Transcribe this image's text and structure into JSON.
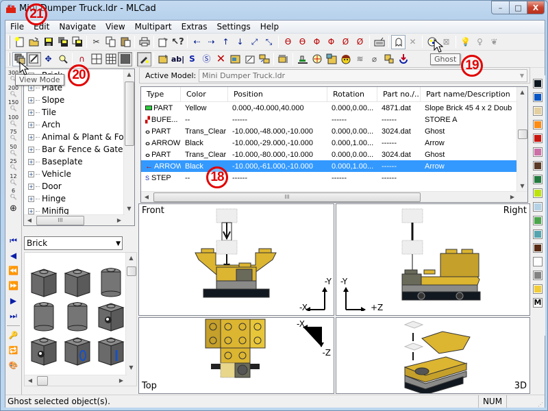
{
  "window": {
    "title": "Mini Dumper Truck.ldr - MLCad",
    "min_label": "–",
    "max_label": "□",
    "close_label": "X"
  },
  "menu": [
    "File",
    "Edit",
    "Navigate",
    "View",
    "Multipart",
    "Extras",
    "Settings",
    "Help"
  ],
  "toolbar1": {
    "groups": [
      [
        "new-icon",
        "open-icon",
        "save-icon",
        "save-as-icon",
        "save-all-icon"
      ],
      [
        "cut-icon",
        "copy-icon",
        "paste-icon"
      ],
      [
        "print-icon"
      ],
      [
        "properties-icon",
        "context-help-icon"
      ],
      [
        "move-neg-x-icon",
        "move-pos-x-icon",
        "move-neg-y-icon",
        "move-pos-y-icon",
        "move-pos-z-icon",
        "move-neg-z-icon"
      ],
      [
        "rotate-x-neg-icon",
        "rotate-x-pos-icon",
        "rotate-y-neg-icon",
        "rotate-y-pos-icon",
        "rotate-z-neg-icon",
        "rotate-z-pos-icon"
      ],
      [
        "keyboard-icon"
      ],
      [
        "ghost-icon",
        "unghost-icon"
      ],
      [
        "color-icon",
        "hide-icon"
      ],
      [
        "light-on-icon",
        "light-off-icon",
        "light-all-icon"
      ]
    ]
  },
  "toolbar2": {
    "groups": [
      [
        "view-mode-icon",
        "edit-mode-icon",
        "move-mode-icon",
        "zoom-mode-icon"
      ],
      [
        "magnet-icon",
        "grid-coarse-icon",
        "grid-medium-icon",
        "grid-fine-icon"
      ],
      [
        "draw-mode-icon"
      ],
      [
        "add-part-icon",
        "add-comment-icon",
        "add-step-icon",
        "add-sub-icon",
        "delete-icon",
        "add-image-icon",
        "add-buffer-icon",
        "swap-buffer-icon"
      ],
      [
        "rotation-step-icon"
      ],
      [
        "ground-icon",
        "rotate-center-icon",
        "bitmap-icon",
        "minifig-icon",
        "spring-icon",
        "hose-icon",
        "band-icon",
        "refresh-icon"
      ]
    ],
    "text_icon": "ab|"
  },
  "tooltips": {
    "ghost": "Ghost",
    "view_mode": "View Mode"
  },
  "annotations": [
    "21",
    "20",
    "19",
    "18"
  ],
  "zoom_levels": [
    "300",
    "200",
    "150",
    "100",
    "75",
    "50",
    "25",
    "12",
    "6",
    "fit"
  ],
  "tree": {
    "items": [
      "Brick",
      "Plate",
      "Slope",
      "Tile",
      "Arch",
      "Animal & Plant & Food",
      "Bar & Fence & Gate",
      "Baseplate",
      "Vehicle",
      "Door",
      "Hinge",
      "Minifig"
    ]
  },
  "nav": [
    "first-step-icon",
    "prev-step-icon",
    "prev-disabled-icon",
    "next-disabled-icon",
    "next-step-icon",
    "last-step-icon"
  ],
  "parts_combo": {
    "value": "Brick"
  },
  "active_model": {
    "label": "Active Model:",
    "value": "Mini Dumper Truck.ldr"
  },
  "table": {
    "columns": [
      "Type",
      "Color",
      "Position",
      "Rotation",
      "Part no./...",
      "Part name/Description"
    ],
    "rows": [
      {
        "icon": "part-icon",
        "type": "PART",
        "color": "Yellow",
        "position": "0.000,-40.000,40.000",
        "rotation": "0.000,0.00...",
        "part_no": "4871.dat",
        "desc": "Slope Brick 45  4 x  2 Doub",
        "selected": false
      },
      {
        "icon": "buffer-icon",
        "type": "BUFE...",
        "color": "--",
        "position": "------",
        "rotation": "------",
        "part_no": "------",
        "desc": "STORE A",
        "selected": false
      },
      {
        "icon": "ghost-icon",
        "type": "PART",
        "color": "Trans_Clear",
        "position": "-10.000,-48.000,-10.000",
        "rotation": "0.000,0.00...",
        "part_no": "3024.dat",
        "desc": "Ghost",
        "selected": false
      },
      {
        "icon": "ghost-icon",
        "type": "ARROW",
        "color": "Black",
        "position": "-10.000,-29.000,-10.000",
        "rotation": "0.000,1.00...",
        "part_no": "------",
        "desc": "Arrow",
        "selected": false
      },
      {
        "icon": "ghost-icon",
        "type": "PART",
        "color": "Trans_Clear",
        "position": "-10.000,-80.000,-10.000",
        "rotation": "0.000,0.00...",
        "part_no": "3024.dat",
        "desc": "Ghost",
        "selected": false
      },
      {
        "icon": "arrow-icon",
        "type": "ARROW",
        "color": "Black",
        "position": "-10.000,-61.000,-10.000",
        "rotation": "0.000,1.00...",
        "part_no": "------",
        "desc": "Arrow",
        "selected": true
      },
      {
        "icon": "step-icon",
        "type": "STEP",
        "color": "--",
        "position": "------",
        "rotation": "------",
        "part_no": "------",
        "desc": "",
        "selected": false
      }
    ]
  },
  "palette": {
    "colors": [
      "#0b1620",
      "#0a55c4",
      "#e4cfa0",
      "#fd8c14",
      "#c8170e",
      "#cc70a8",
      "#5b3a26",
      "#237a3e",
      "#bde30d",
      "#b4d2e6",
      "#4ba64b",
      "#55a5af",
      "#582a14",
      "#ffffff",
      "#828282",
      "#f2cd37"
    ],
    "more_label": "M"
  },
  "viewports": {
    "front": {
      "label": "Front",
      "axis_h": "-X",
      "axis_v": "-Y"
    },
    "right": {
      "label": "Right",
      "axis_h": "+Z",
      "axis_v": "-Y"
    },
    "top": {
      "label": "Top",
      "axis_h": "-X",
      "axis_v": "-Z"
    },
    "3d": {
      "label": "3D"
    }
  },
  "status": {
    "message": "Ghost selected object(s).",
    "num": "NUM"
  }
}
